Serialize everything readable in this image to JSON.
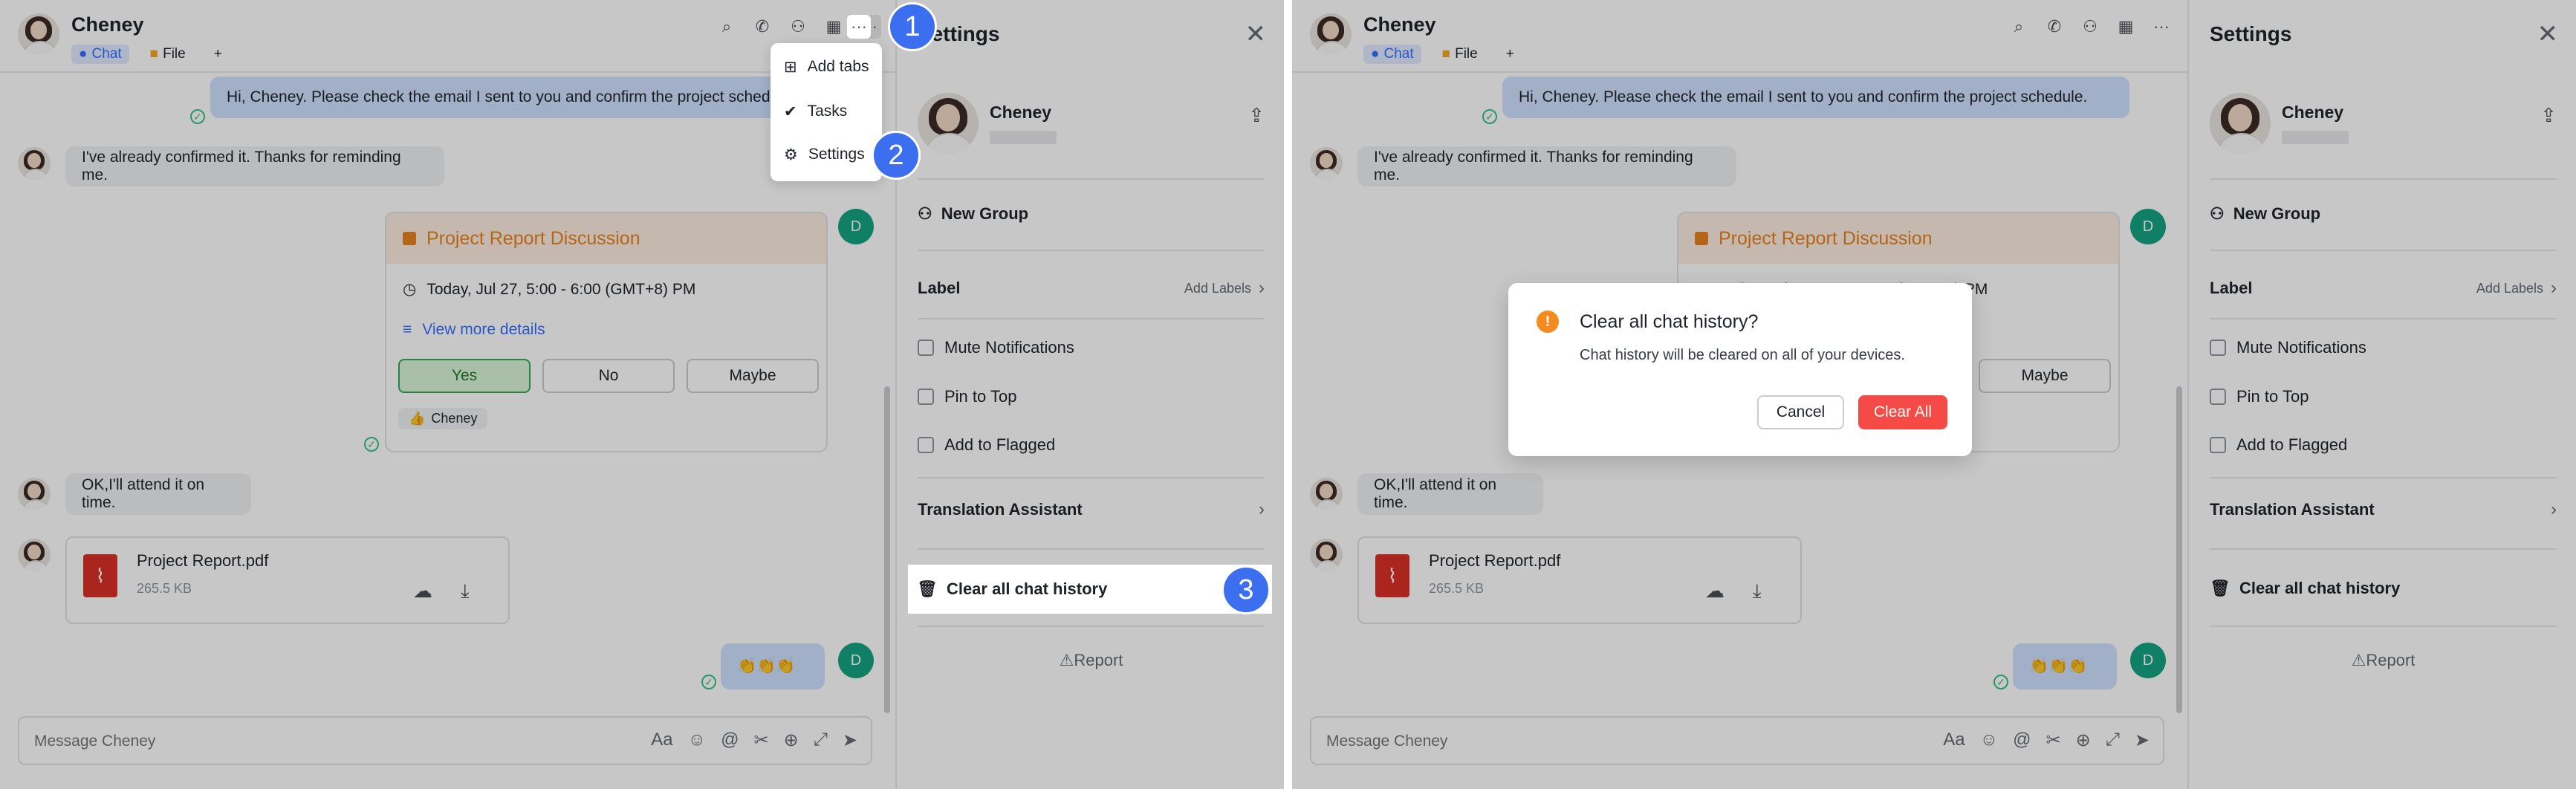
{
  "chat": {
    "contact_name": "Cheney",
    "tabs": [
      {
        "label": "Chat"
      },
      {
        "label": "File"
      }
    ],
    "add_tab": "+",
    "messages": {
      "m1": "Hi, Cheney. Please check the email I sent to you and confirm the project schedule.",
      "m2": "I've already confirmed it. Thanks for reminding me.",
      "m3": "OK,I'll attend it on time.",
      "emoji": "👏👏👏"
    },
    "event_card": {
      "title": "Project Report Discussion",
      "time": "Today, Jul 27, 5:00 - 6:00 (GMT+8) PM",
      "details_link": "View more details",
      "yes": "Yes",
      "no": "No",
      "maybe": "Maybe",
      "reaction_user": "Cheney"
    },
    "file": {
      "name": "Project Report.pdf",
      "size": "265.5 KB"
    },
    "sender_initial": "D",
    "composer_placeholder": "Message Cheney",
    "composer_text_icon": "Aa"
  },
  "menu": {
    "add_tabs": "Add tabs",
    "tasks": "Tasks",
    "settings": "Settings",
    "more": "···"
  },
  "settings": {
    "title": "Settings",
    "name": "Cheney",
    "new_group": "New Group",
    "label": "Label",
    "add_labels": "Add Labels",
    "mute": "Mute Notifications",
    "pin": "Pin to Top",
    "flag": "Add to Flagged",
    "translation": "Translation Assistant",
    "clear_history": "Clear all chat history",
    "report": "Report"
  },
  "dialog": {
    "title": "Clear all chat history?",
    "body": "Chat history will be cleared on all of your devices.",
    "cancel": "Cancel",
    "confirm": "Clear All"
  },
  "steps": [
    "1",
    "2",
    "3"
  ],
  "colors": {
    "accent": "#3370ff",
    "step_badge": "#3b6ff0",
    "danger": "#f54a45",
    "warning": "#f58a1f",
    "event_orange": "#e8821e"
  }
}
